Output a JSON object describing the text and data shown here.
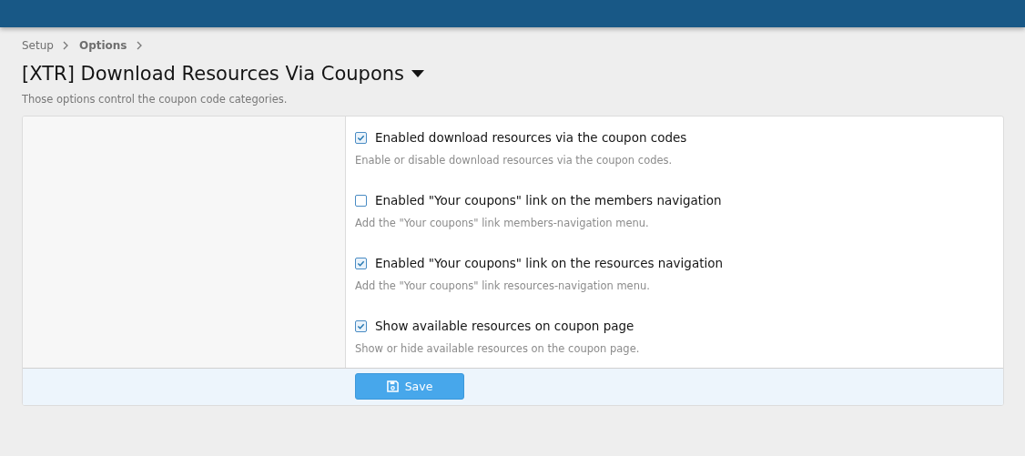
{
  "breadcrumb": [
    {
      "label": "Setup",
      "current": false
    },
    {
      "label": "Options",
      "current": true
    }
  ],
  "title": "[XTR] Download Resources Via Coupons",
  "description": "Those options control the coupon code categories.",
  "options": [
    {
      "label": "Enabled download resources via the coupon codes",
      "hint": "Enable or disable download resources via the coupon codes.",
      "checked": true
    },
    {
      "label": "Enabled \"Your coupons\" link on the members navigation",
      "hint": "Add the \"Your coupons\" link members-navigation menu.",
      "checked": false
    },
    {
      "label": "Enabled \"Your coupons\" link on the resources navigation",
      "hint": "Add the \"Your coupons\" link resources-navigation menu.",
      "checked": true
    },
    {
      "label": "Show available resources on coupon page",
      "hint": "Show or hide available resources on the coupon page.",
      "checked": true
    }
  ],
  "save_button": "Save"
}
